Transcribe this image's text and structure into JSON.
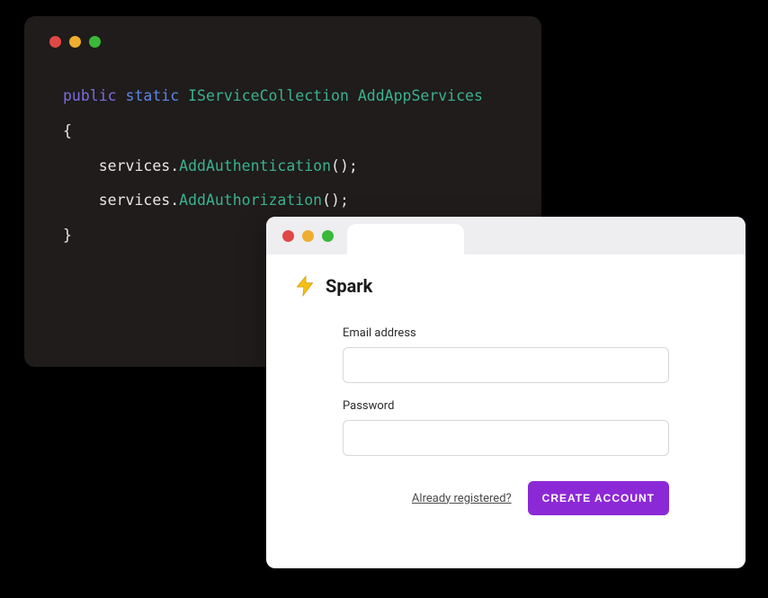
{
  "code": {
    "line1": {
      "public": "public",
      "static": "static",
      "type": "IServiceCollection",
      "method": "AddAppServices"
    },
    "open_brace": "{",
    "line2": {
      "prefix": "    services.",
      "call": "AddAuthentication",
      "suffix": "();"
    },
    "line3": {
      "prefix": "    services.",
      "call": "AddAuthorization",
      "suffix": "();"
    },
    "close_brace": "}"
  },
  "browser": {
    "brand_name": "Spark",
    "email_label": "Email address",
    "password_label": "Password",
    "already_link": "Already registered?",
    "create_button": "CREATE ACCOUNT"
  }
}
